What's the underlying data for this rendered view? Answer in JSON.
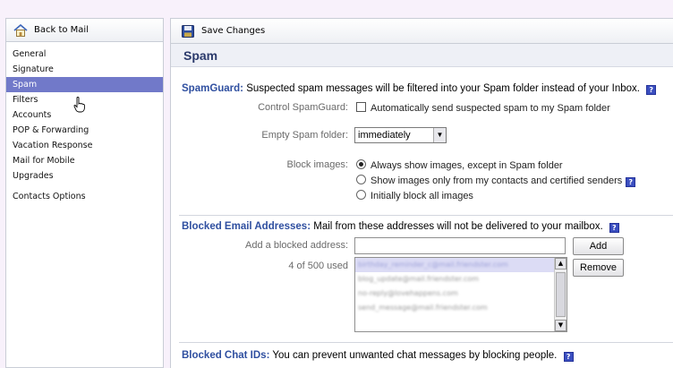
{
  "sidebar": {
    "back_label": "Back to Mail",
    "items": [
      {
        "label": "General"
      },
      {
        "label": "Signature"
      },
      {
        "label": "Spam",
        "active": true
      },
      {
        "label": "Filters"
      },
      {
        "label": "Accounts"
      },
      {
        "label": "POP & Forwarding"
      },
      {
        "label": "Vacation Response"
      },
      {
        "label": "Mail for Mobile"
      },
      {
        "label": "Upgrades"
      },
      {
        "label": "Contacts Options"
      }
    ]
  },
  "toolbar": {
    "save_label": "Save Changes"
  },
  "page": {
    "title": "Spam"
  },
  "spamguard": {
    "heading": "SpamGuard:",
    "description": "Suspected spam messages will be filtered into your Spam folder instead of your Inbox.",
    "control_label": "Control SpamGuard:",
    "checkbox_label": "Automatically send suspected spam to my Spam folder",
    "empty_label": "Empty Spam folder:",
    "empty_value": "immediately",
    "block_images_label": "Block images:",
    "radio_options": [
      "Always show images, except in Spam folder",
      "Show images only from my contacts and certified senders",
      "Initially block all images"
    ],
    "selected_option": 0
  },
  "blocked_email": {
    "heading": "Blocked Email Addresses:",
    "description": "Mail from these addresses will not be delivered to your mailbox.",
    "add_label": "Add a blocked address:",
    "input_value": "",
    "add_button": "Add",
    "count_text": "4 of 500 used",
    "remove_button": "Remove",
    "addresses": [
      "birthday_reminder_c@mail.friendster.com",
      "blog_update@mail.friendster.com",
      "no-reply@lovehappens.com",
      "send_message@mail.friendster.com"
    ]
  },
  "blocked_chat": {
    "heading": "Blocked Chat IDs:",
    "description": "You can prevent unwanted chat messages by blocking people."
  },
  "colors": {
    "accent": "#7179c9",
    "heading_blue": "#2f4fa0",
    "title_blue": "#2b3a6b",
    "help_blue": "#3b4fc0"
  }
}
